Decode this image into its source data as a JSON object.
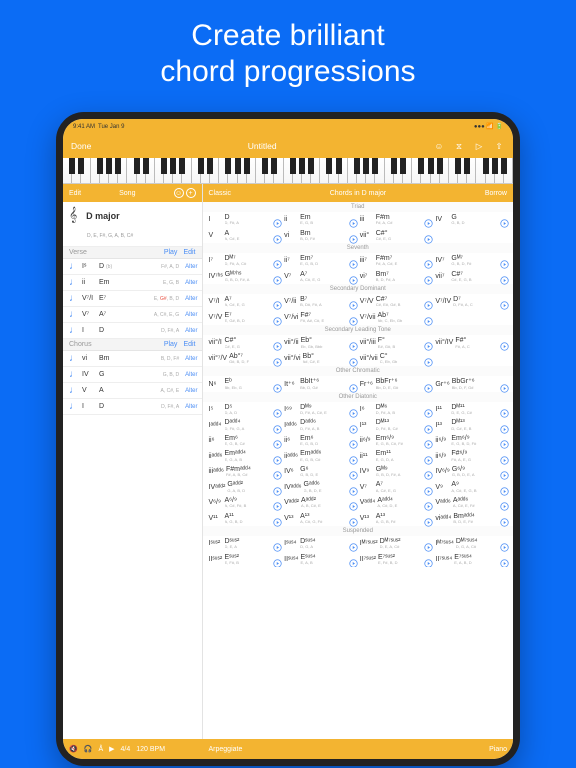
{
  "headline_line1": "Create brilliant",
  "headline_line2": "chord progressions",
  "status": {
    "time": "9:41 AM",
    "date": "Tue Jan 9"
  },
  "nav": {
    "done": "Done",
    "title": "Untitled"
  },
  "left": {
    "edit": "Edit",
    "tab": "Song",
    "key": {
      "name": "D major",
      "notes": "D, E, F#, G, A, B, C#"
    },
    "sections": [
      {
        "name": "Verse",
        "play": "Play",
        "edit": "Edit",
        "rows": [
          {
            "num": "Iˢ",
            "chord": "D",
            "sub": "(b)",
            "notes": "F#, A, D",
            "alter": "Alter"
          },
          {
            "num": "ii",
            "chord": "Em",
            "sub": "",
            "notes": "E, G, B",
            "alter": "Alter"
          },
          {
            "num": "V⁷/I",
            "chord": "E⁷",
            "sub": "",
            "notes": "E, G#, B, D",
            "alter": "Alter",
            "highlight": true
          },
          {
            "num": "V⁷",
            "chord": "A⁷",
            "sub": "",
            "notes": "A, C#, E, G",
            "alter": "Alter"
          },
          {
            "num": "I",
            "chord": "D",
            "sub": "",
            "notes": "D, F#, A",
            "alter": "Alter"
          }
        ]
      },
      {
        "name": "Chorus",
        "play": "Play",
        "edit": "Edit",
        "rows": [
          {
            "num": "vi",
            "chord": "Bm",
            "sub": "",
            "notes": "B, D, F#",
            "alter": "Alter"
          },
          {
            "num": "IV",
            "chord": "G",
            "sub": "",
            "notes": "G, B, D",
            "alter": "Alter"
          },
          {
            "num": "V",
            "chord": "A",
            "sub": "",
            "notes": "A, C#, E",
            "alter": "Alter"
          },
          {
            "num": "I",
            "chord": "D",
            "sub": "",
            "notes": "D, F#, A",
            "alter": "Alter"
          }
        ]
      }
    ]
  },
  "right": {
    "classic": "Classic",
    "title": "Chords in D major",
    "borrow": "Borrow",
    "sections": [
      {
        "name": "Triad",
        "rows": [
          [
            [
              "I",
              "D",
              "D, F#, A"
            ],
            [
              "ii",
              "Em",
              "E, G, B"
            ],
            [
              "iii",
              "F#m",
              "F#, A, C#"
            ],
            [
              "IV",
              "G",
              "G, B, D"
            ]
          ],
          [
            [
              "V",
              "A",
              "A, C#, E"
            ],
            [
              "vi",
              "Bm",
              "B, D, F#"
            ],
            [
              "vii°",
              "C#°",
              "C#, E, G"
            ],
            [
              "",
              "",
              ""
            ]
          ]
        ]
      },
      {
        "name": "Seventh",
        "rows": [
          [
            [
              "I⁷",
              "Dᴹ⁷",
              "D, F#, A, C#"
            ],
            [
              "ii⁷",
              "Em⁷",
              "E, G, B, D"
            ],
            [
              "iii⁷",
              "F#m⁷",
              "F#, A, C#, E"
            ],
            [
              "IV⁷",
              "Gᴹ⁷",
              "G, B, D, F#"
            ]
          ],
          [
            [
              "IV⁷ʰˢ",
              "Gᴹ⁷ʰˢ",
              "G, B, D, F#, A"
            ],
            [
              "V⁷",
              "A⁷",
              "A, C#, E, G"
            ],
            [
              "vi⁷",
              "Bm⁷",
              "B, D, F#, A"
            ],
            [
              "vii⁷",
              "C#⁷",
              "C#, E, G, B"
            ]
          ]
        ]
      },
      {
        "name": "Secondary Dominant",
        "rows": [
          [
            [
              "V⁷/I",
              "A⁷",
              "A, C#, E, G"
            ],
            [
              "V⁷/ii",
              "B⁷",
              "B, D#, F#, A"
            ],
            [
              "V⁷/V",
              "C#⁷",
              "C#, E#, G#, B"
            ],
            [
              "V⁷/IV",
              "D⁷",
              "D, F#, A, C"
            ]
          ],
          [
            [
              "V⁷/V",
              "E⁷",
              "E, G#, B, D"
            ],
            [
              "V⁷/vi",
              "F#⁷",
              "F#, A#, C#, E"
            ],
            [
              "V⁷/vii",
              "Ab⁷",
              "Ab, C, Eb, Gb"
            ],
            [
              "",
              "",
              ""
            ]
          ]
        ]
      },
      {
        "name": "Secondary Leading Tone",
        "rows": [
          [
            [
              "vii°/I",
              "C#°",
              "C#, E, G"
            ],
            [
              "vii°/ii",
              "Eb°",
              "Eb, Gb, Bbb"
            ],
            [
              "vii°/iii",
              "F°",
              "E#, G#, B"
            ],
            [
              "vii°/IV",
              "F#°",
              "F#, A, C"
            ]
          ],
          [
            [
              "vii°⁷/V",
              "Ab°⁷",
              "G#, B, D, F"
            ],
            [
              "vii°/vi",
              "Bb°",
              "A#, C#, E"
            ],
            [
              "vii°/vii",
              "C°",
              "C, Eb, Gb"
            ],
            [
              "",
              "",
              ""
            ]
          ]
        ]
      },
      {
        "name": "Other Chromatic",
        "rows": [
          [
            [
              "N⁶",
              "Eᵇ",
              "Bb, Eb, G"
            ],
            [
              "It⁺⁶",
              "BbIt⁺⁶",
              "Bb, D, G#"
            ],
            [
              "Fr⁺⁶",
              "BbFr⁺⁶",
              "Bb, D, E, G#"
            ],
            [
              "Gr⁺⁶",
              "BbGr⁺⁶",
              "Bb, D, F, G#"
            ]
          ]
        ]
      },
      {
        "name": "Other Diatonic",
        "rows": [
          [
            [
              "I⁵",
              "D⁵",
              "D, A, D"
            ],
            [
              "I⁶⁹",
              "Dᴹ⁹",
              "D, F#, A, C#, E"
            ],
            [
              "I⁶",
              "Dᴹ⁶",
              "D, F#, A, B"
            ],
            [
              "I¹¹",
              "Dᴹ¹¹",
              "D, E, G, C#"
            ]
          ],
          [
            [
              "Iᵃᵈᵈ⁴",
              "Dᵃᵈᵈ⁴",
              "D, F#, G, A"
            ],
            [
              "Iᵃᵈᵈ⁶",
              "Dᵃᵈᵈ⁶",
              "D, F#, A, B"
            ],
            [
              "I¹³",
              "Dᴹ¹³",
              "D, F#, B, C#"
            ],
            [
              "I¹³",
              "Dᴹ¹³",
              "D, C#, E, B"
            ]
          ],
          [
            [
              "ii⁶",
              "Em⁶",
              "E, G, B, C#"
            ],
            [
              "ii⁶",
              "Em⁶",
              "E, G, B, D"
            ],
            [
              "ii⁶/⁹",
              "Em⁶/⁹",
              "E, G, B, C#, F#"
            ],
            [
              "ii⁶/⁹",
              "Em⁶/⁹",
              "E, G, B, D, F#"
            ]
          ],
          [
            [
              "iiᵃᵈᵈ⁶",
              "Emᵃᵈᵈ⁴",
              "E, G, A, B"
            ],
            [
              "iiᵃᵈᵈ⁶",
              "Emᵃᵈᵈ⁶",
              "E, G, B, C#"
            ],
            [
              "ii¹¹",
              "Em¹¹",
              "E, G, D, A"
            ],
            [
              "ii⁶/⁹",
              "F#⁶/⁹",
              "F#, A, E, G"
            ]
          ],
          [
            [
              "iiiᵃᵈᵈ⁶",
              "F#mᵃᵈᵈ⁴",
              "F#, A, B, C#"
            ],
            [
              "IV⁶",
              "G⁶",
              "G, B, D, E"
            ],
            [
              "IV⁹",
              "Gᴹ⁹",
              "G, B, D, F#, A"
            ],
            [
              "IV⁶/⁹",
              "G⁶/⁹",
              "G, B, D, E, A"
            ]
          ],
          [
            [
              "IVᵃᵈᵈ²",
              "Gᵃᵈᵈ²",
              "G, A, B, D"
            ],
            [
              "IVᵃᵈᵈ⁶",
              "Gᵃᵈᵈ⁶",
              "G, B, D, E"
            ],
            [
              "V⁷",
              "A⁷",
              "A, C#, E, G"
            ],
            [
              "V⁹",
              "A⁹",
              "A, C#, E, G, B"
            ]
          ],
          [
            [
              "V⁶/⁹",
              "A⁶/⁹",
              "A, C#, F#, B"
            ],
            [
              "Vᵃᵈᵈ²",
              "Aᵃᵈᵈ²",
              "A, B, C#, E"
            ],
            [
              "Vᵃᵈᵈ⁴",
              "Aᵃᵈᵈ⁴",
              "A, C#, D, E"
            ],
            [
              "Vᵃᵈᵈ⁶",
              "Aᵃᵈᵈ⁶",
              "A, C#, E, F#"
            ]
          ],
          [
            [
              "V¹¹",
              "A¹¹",
              "A, G, B, D"
            ],
            [
              "V¹³",
              "A¹³",
              "A, C#, G, F#"
            ],
            [
              "V¹³",
              "A¹³",
              "A, G, B, F#"
            ],
            [
              "viᵃᵈᵈ⁴",
              "Bmᵃᵈᵈ⁴",
              "B, D, E, F#"
            ]
          ]
        ]
      },
      {
        "name": "Suspended",
        "rows": [
          [
            [
              "Iˢᵘˢ²",
              "Dˢᵘˢ²",
              "D, E, A"
            ],
            [
              "Iˢᵘˢ⁴",
              "Dˢᵘˢ⁴",
              "D, G, A"
            ],
            [
              "Iᴹ⁷ˢᵘˢ²",
              "Dᴹ⁷ˢᵘˢ²",
              "D, E, A, C#"
            ],
            [
              "Iᴹ⁷ˢᵘˢ⁴",
              "Dᴹ⁷ˢᵘˢ⁴",
              "D, G, A, C#"
            ]
          ],
          [
            [
              "IIˢᵘˢ²",
              "Eˢᵘˢ²",
              "E, F#, B"
            ],
            [
              "IIˢᵘˢ⁴",
              "Eˢᵘˢ⁴",
              "E, A, B"
            ],
            [
              "II⁷ˢᵘˢ²",
              "E⁷ˢᵘˢ²",
              "E, F#, B, D"
            ],
            [
              "II⁷ˢᵘˢ⁴",
              "E⁷ˢᵘˢ⁴",
              "E, A, B, D"
            ]
          ]
        ]
      }
    ]
  },
  "footer": {
    "ts": "4/4",
    "bpm": "120 BPM",
    "arp": "Arpeggiate",
    "instr": "Piano"
  }
}
